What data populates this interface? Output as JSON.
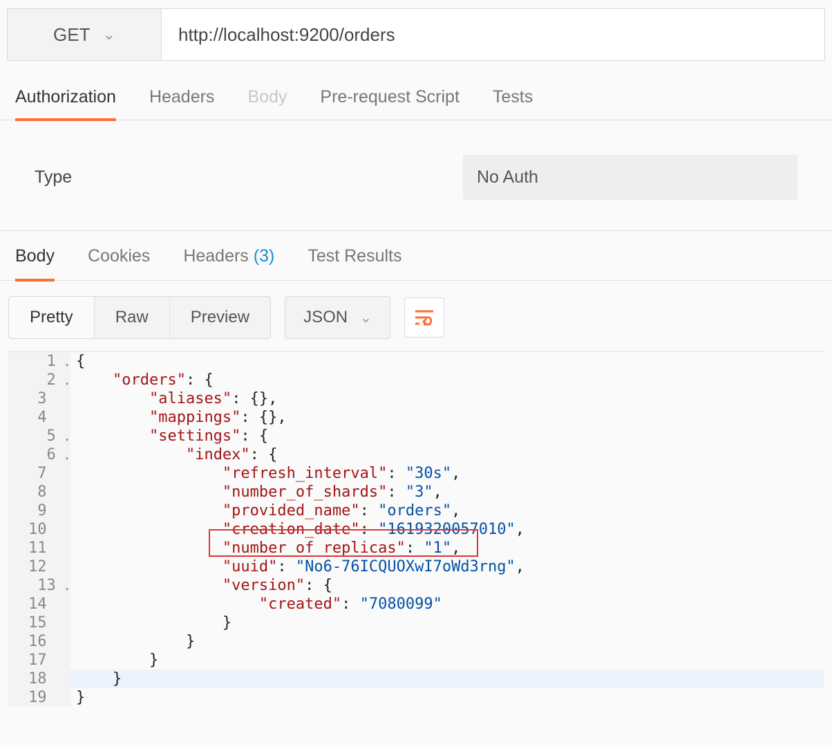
{
  "request": {
    "method": "GET",
    "url": "http://localhost:9200/orders"
  },
  "request_tabs": {
    "authorization": "Authorization",
    "headers": "Headers",
    "body": "Body",
    "prerequest": "Pre-request Script",
    "tests": "Tests",
    "active": "authorization"
  },
  "auth": {
    "type_label": "Type",
    "value": "No Auth"
  },
  "response_tabs": {
    "body": "Body",
    "cookies": "Cookies",
    "headers": "Headers",
    "headers_count": "(3)",
    "test_results": "Test Results",
    "active": "body"
  },
  "view_modes": {
    "pretty": "Pretty",
    "raw": "Raw",
    "preview": "Preview",
    "active": "pretty"
  },
  "format_select": "JSON",
  "code": {
    "lines": [
      {
        "n": "1",
        "foldable": true
      },
      {
        "n": "2",
        "foldable": true
      },
      {
        "n": "3"
      },
      {
        "n": "4"
      },
      {
        "n": "5",
        "foldable": true
      },
      {
        "n": "6",
        "foldable": true
      },
      {
        "n": "7"
      },
      {
        "n": "8"
      },
      {
        "n": "9"
      },
      {
        "n": "10"
      },
      {
        "n": "11"
      },
      {
        "n": "12"
      },
      {
        "n": "13",
        "foldable": true
      },
      {
        "n": "14"
      },
      {
        "n": "15"
      },
      {
        "n": "16"
      },
      {
        "n": "17"
      },
      {
        "n": "18"
      },
      {
        "n": "19"
      }
    ],
    "content": {
      "orders_key": "\"orders\"",
      "aliases_key": "\"aliases\"",
      "mappings_key": "\"mappings\"",
      "settings_key": "\"settings\"",
      "index_key": "\"index\"",
      "refresh_interval_key": "\"refresh_interval\"",
      "refresh_interval_val": "\"30s\"",
      "number_of_shards_key": "\"number_of_shards\"",
      "number_of_shards_val": "\"3\"",
      "provided_name_key": "\"provided_name\"",
      "provided_name_val": "\"orders\"",
      "creation_date_key": "\"creation_date\"",
      "creation_date_val": "\"1619320057010\"",
      "number_of_replicas_key": "\"number_of_replicas\"",
      "number_of_replicas_val": "\"1\"",
      "uuid_key": "\"uuid\"",
      "uuid_val": "\"No6-76ICQUOXwI7oWd3rng\"",
      "version_key": "\"version\"",
      "created_key": "\"created\"",
      "created_val": "\"7080099\""
    },
    "highlighted_line": 11
  }
}
